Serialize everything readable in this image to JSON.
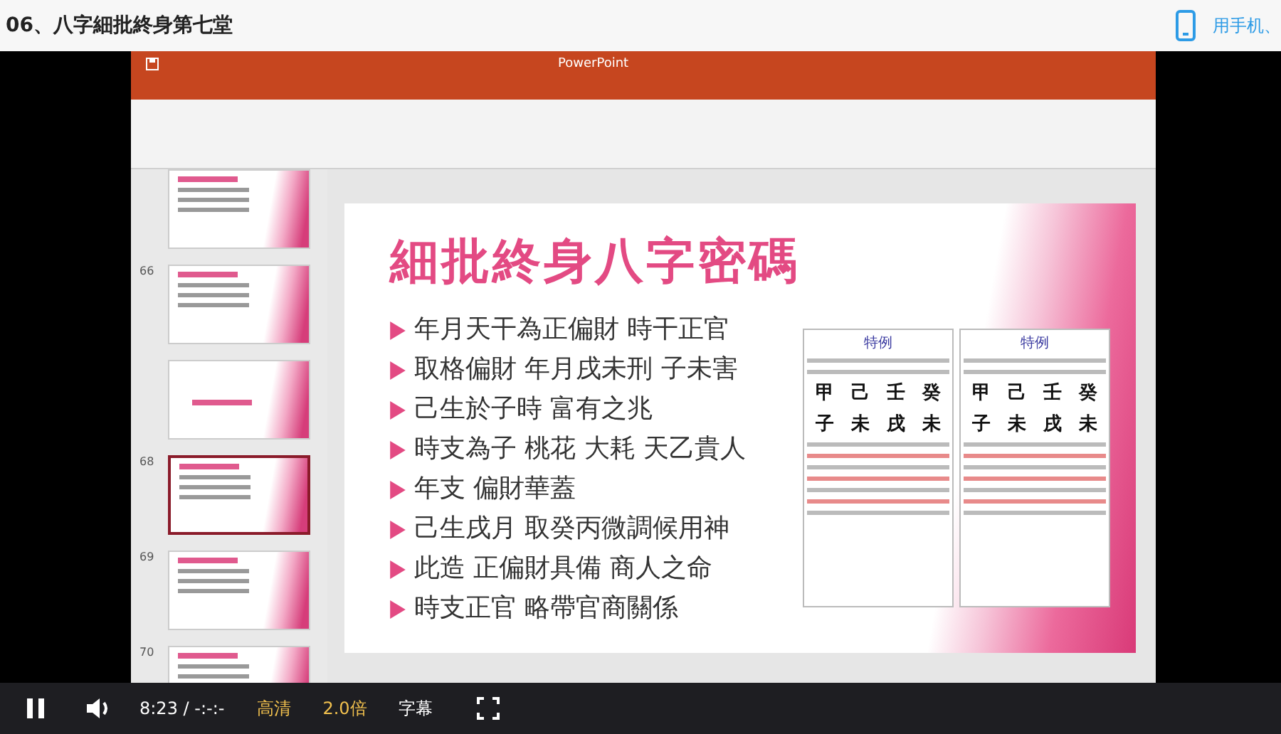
{
  "header": {
    "title": "06、八字細批終身第七堂",
    "mobile_label": "用手机、"
  },
  "ppt": {
    "app_name": "PowerPoint",
    "thumbnails": [
      {
        "kind": "content",
        "selected": false
      },
      {
        "kind": "content",
        "number": "66",
        "selected": false
      },
      {
        "kind": "title",
        "selected": false
      },
      {
        "kind": "content",
        "number": "68",
        "selected": true
      },
      {
        "kind": "content",
        "number": "69",
        "selected": false
      },
      {
        "kind": "content",
        "number": "70",
        "selected": false
      }
    ],
    "slide": {
      "title": "細批終身八字密碼",
      "bullets": [
        "年月天干為正偏財 時干正官",
        "取格偏財 年月戌未刑 子未害",
        "己生於子時 富有之兆",
        "時支為子 桃花 大耗 天乙貴人",
        "年支 偏財華蓋",
        "己生戌月 取癸丙微調候用神",
        "此造 正偏財具備 商人之命",
        "時支正官 略帶官商關係"
      ],
      "charts": [
        {
          "label": "特例",
          "stems": [
            "甲",
            "己",
            "壬",
            "癸"
          ],
          "branches": [
            "子",
            "未",
            "戌",
            "未"
          ]
        },
        {
          "label": "特例",
          "stems": [
            "甲",
            "己",
            "壬",
            "癸"
          ],
          "branches": [
            "子",
            "未",
            "戌",
            "未"
          ]
        }
      ]
    }
  },
  "player": {
    "playing": true,
    "time": "8:23 / -:-:-",
    "quality": "高清",
    "speed": "2.0倍",
    "subtitles": "字幕"
  }
}
